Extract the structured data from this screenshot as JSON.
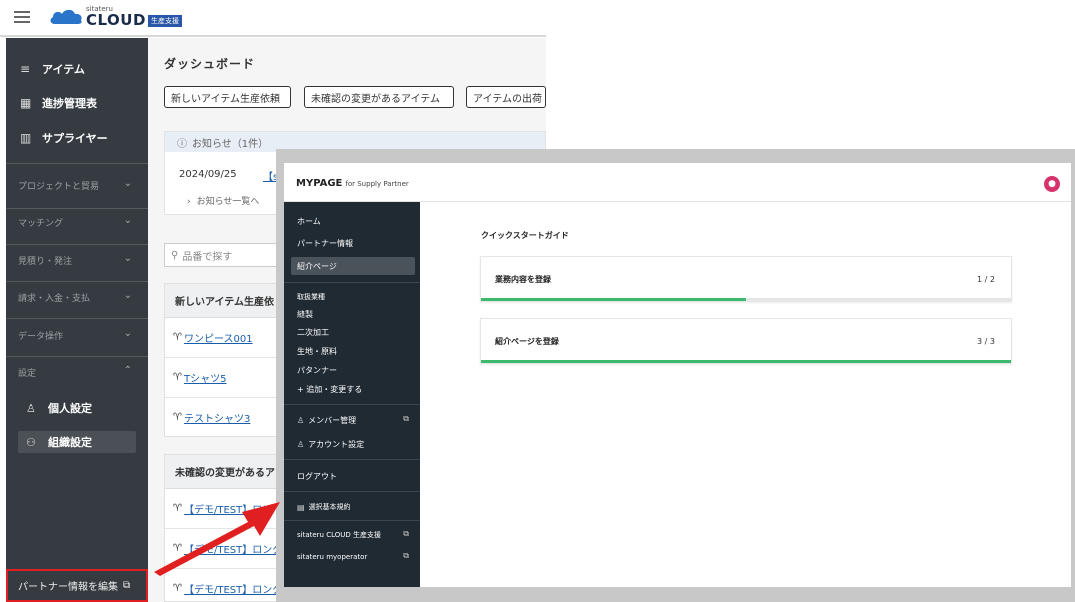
{
  "bg_app": {
    "logo": {
      "small_text": "sitateru",
      "text": "CLOUD",
      "badge": "生産支援"
    },
    "sidebar": {
      "main_items": [
        {
          "icon": "≡",
          "label": "アイテム"
        },
        {
          "icon": "▦",
          "label": "進捗管理表"
        },
        {
          "icon": "▥",
          "label": "サプライヤー"
        }
      ],
      "sections": [
        "プロジェクトと貿易",
        "マッチング",
        "見積り・発注",
        "請求・入金・支払",
        "データ操作",
        "設定"
      ],
      "settings_items": [
        {
          "icon": "♙",
          "label": "個人設定"
        },
        {
          "icon": "⚇",
          "label": "組織設定"
        }
      ],
      "partner_edit": "パートナー情報を編集"
    },
    "main": {
      "title": "ダッシュボード",
      "buttons": [
        "新しいアイテム生産依頼",
        "未確認の変更があるアイテム",
        "アイテムの出荷"
      ],
      "notice": {
        "header": "お知らせ（1件）",
        "date": "2024/09/25",
        "link": "【s",
        "more": "お知らせ一覧へ"
      },
      "search_placeholder": "品番で探す",
      "card1": {
        "header": "新しいアイテム生産依",
        "rows": [
          "ワンピース001",
          "Tシャツ5",
          "テストシャツ3"
        ]
      },
      "card2": {
        "header": "未確認の変更があるア",
        "rows": [
          "【デモ/TEST】ロン",
          "【デモ/TEST】ロング",
          "【デモ/TEST】ロング"
        ]
      }
    }
  },
  "mypage": {
    "title": "MYPAGE",
    "subtitle": "for Supply Partner",
    "nav_top": [
      "ホーム",
      "パートナー情報",
      "紹介ページ"
    ],
    "business_title": "取扱業種",
    "business_items": [
      "縫製",
      "二次加工",
      "生地・原料",
      "パタンナー",
      "+ 追加・変更する"
    ],
    "nav_mid": [
      {
        "icon": "♙",
        "label": "メンバー管理",
        "external": true
      },
      {
        "icon": "♙",
        "label": "アカウント設定",
        "external": false
      }
    ],
    "logout": "ログアウト",
    "terms": "選択基本規約",
    "links": [
      "sitateru CLOUD 生産支援",
      "sitateru myoperator"
    ],
    "content": {
      "guide_title": "クイックスタートガイド",
      "cards": [
        {
          "label": "業務内容を登録",
          "count": "1 / 2",
          "progress": 0.5
        },
        {
          "label": "紹介ページを登録",
          "count": "3 / 3",
          "progress": 1.0
        }
      ]
    }
  },
  "colors": {
    "sidebar_bg": "#353b40",
    "mypage_sidebar_bg": "#1f2a33",
    "progress_green": "#3dba6e",
    "highlight_red": "#e02020",
    "avatar_pink": "#d6336c"
  }
}
